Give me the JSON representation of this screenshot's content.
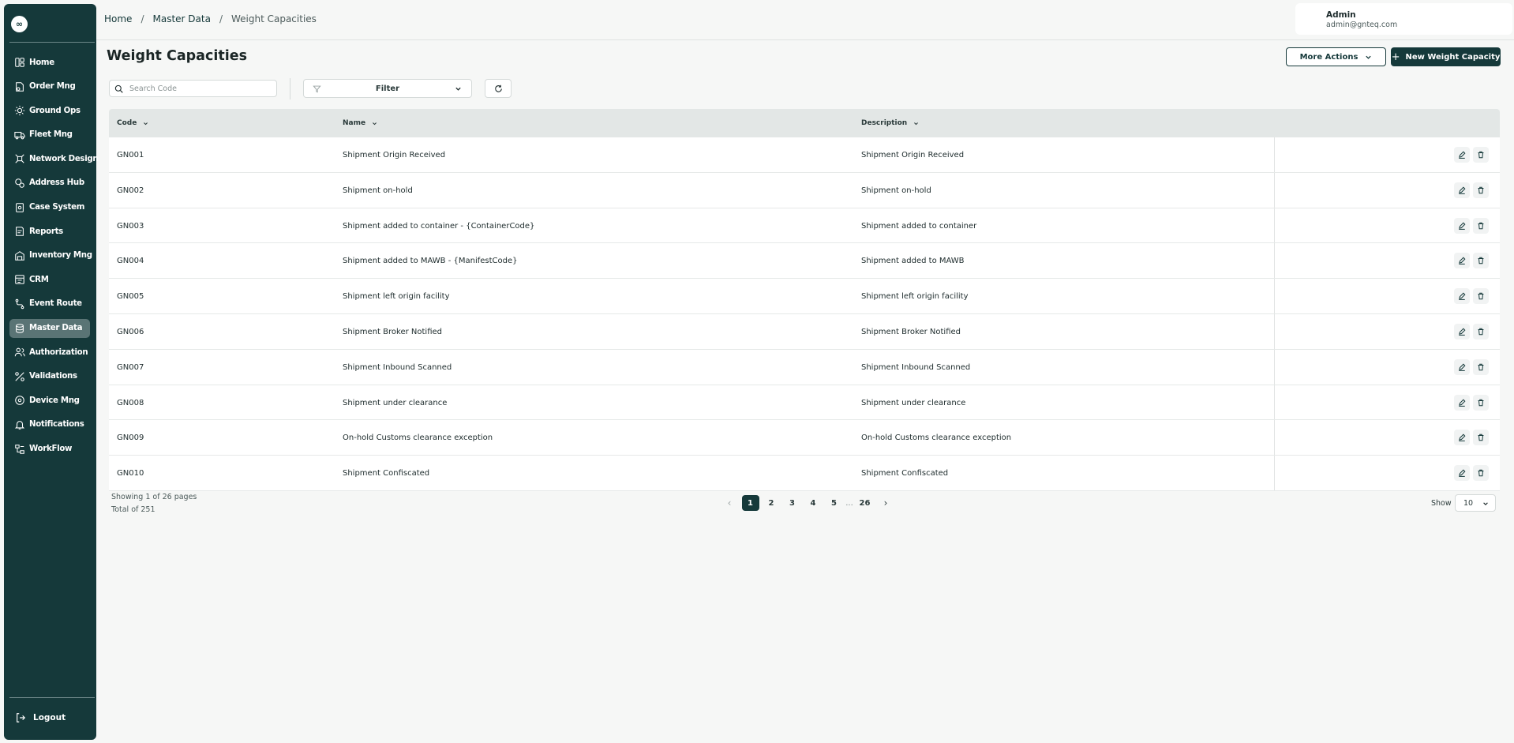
{
  "sidebar": {
    "logo": "∞",
    "items": [
      {
        "label": "Home",
        "icon": "dashboard-icon"
      },
      {
        "label": "Order Mng",
        "icon": "order-icon"
      },
      {
        "label": "Ground Ops",
        "icon": "ground-ops-icon"
      },
      {
        "label": "Fleet Mng",
        "icon": "truck-icon"
      },
      {
        "label": "Network Design",
        "icon": "network-icon"
      },
      {
        "label": "Address Hub",
        "icon": "address-icon"
      },
      {
        "label": "Case System",
        "icon": "case-icon"
      },
      {
        "label": "Reports",
        "icon": "report-icon"
      },
      {
        "label": "Inventory Mng",
        "icon": "inventory-icon"
      },
      {
        "label": "CRM",
        "icon": "crm-icon"
      },
      {
        "label": "Event Route",
        "icon": "route-icon"
      },
      {
        "label": "Master Data",
        "icon": "database-icon",
        "active": true
      },
      {
        "label": "Authorization",
        "icon": "users-icon"
      },
      {
        "label": "Validations",
        "icon": "validation-icon"
      },
      {
        "label": "Device Mng",
        "icon": "device-icon"
      },
      {
        "label": "Notifications",
        "icon": "bell-icon"
      },
      {
        "label": "WorkFlow",
        "icon": "workflow-icon"
      }
    ],
    "logout": "Logout"
  },
  "header": {
    "breadcrumb": {
      "home": "Home",
      "section": "Master Data",
      "current": "Weight Capacities"
    },
    "user": {
      "name": "Admin",
      "email": "admin@gnteq.com"
    }
  },
  "page": {
    "title": "Weight Capacities",
    "more_actions": "More Actions",
    "new_button": "New Weight Capacity",
    "search_placeholder": "Search Code",
    "filter_label": "Filter"
  },
  "table": {
    "columns": {
      "code": "Code",
      "name": "Name",
      "description": "Description"
    },
    "rows": [
      {
        "code": "GN001",
        "name": "Shipment Origin Received",
        "description": "Shipment Origin Received"
      },
      {
        "code": "GN002",
        "name": "Shipment on-hold",
        "description": "Shipment on-hold"
      },
      {
        "code": "GN003",
        "name": "Shipment added to container - {ContainerCode}",
        "description": "Shipment added to container"
      },
      {
        "code": "GN004",
        "name": "Shipment added to MAWB - {ManifestCode}",
        "description": "Shipment added to MAWB"
      },
      {
        "code": "GN005",
        "name": "Shipment left origin facility",
        "description": "Shipment left origin facility"
      },
      {
        "code": "GN006",
        "name": "Shipment Broker Notified",
        "description": "Shipment Broker Notified"
      },
      {
        "code": "GN007",
        "name": "Shipment Inbound Scanned",
        "description": "Shipment Inbound Scanned"
      },
      {
        "code": "GN008",
        "name": "Shipment under clearance",
        "description": "Shipment under clearance"
      },
      {
        "code": "GN009",
        "name": "On-hold Customs clearance exception",
        "description": "On-hold Customs clearance exception"
      },
      {
        "code": "GN010",
        "name": "Shipment Confiscated",
        "description": "Shipment Confiscated"
      }
    ]
  },
  "footer": {
    "showing": "Showing 1 of 26 pages",
    "total": "Total of 251",
    "pages": [
      "1",
      "2",
      "3",
      "4",
      "5"
    ],
    "ellipsis": "...",
    "last_page": "26",
    "show_label": "Show",
    "page_size": "10"
  },
  "colors": {
    "primary": "#15393a",
    "active_nav": "#5a7475",
    "background": "#f6f7f6"
  }
}
